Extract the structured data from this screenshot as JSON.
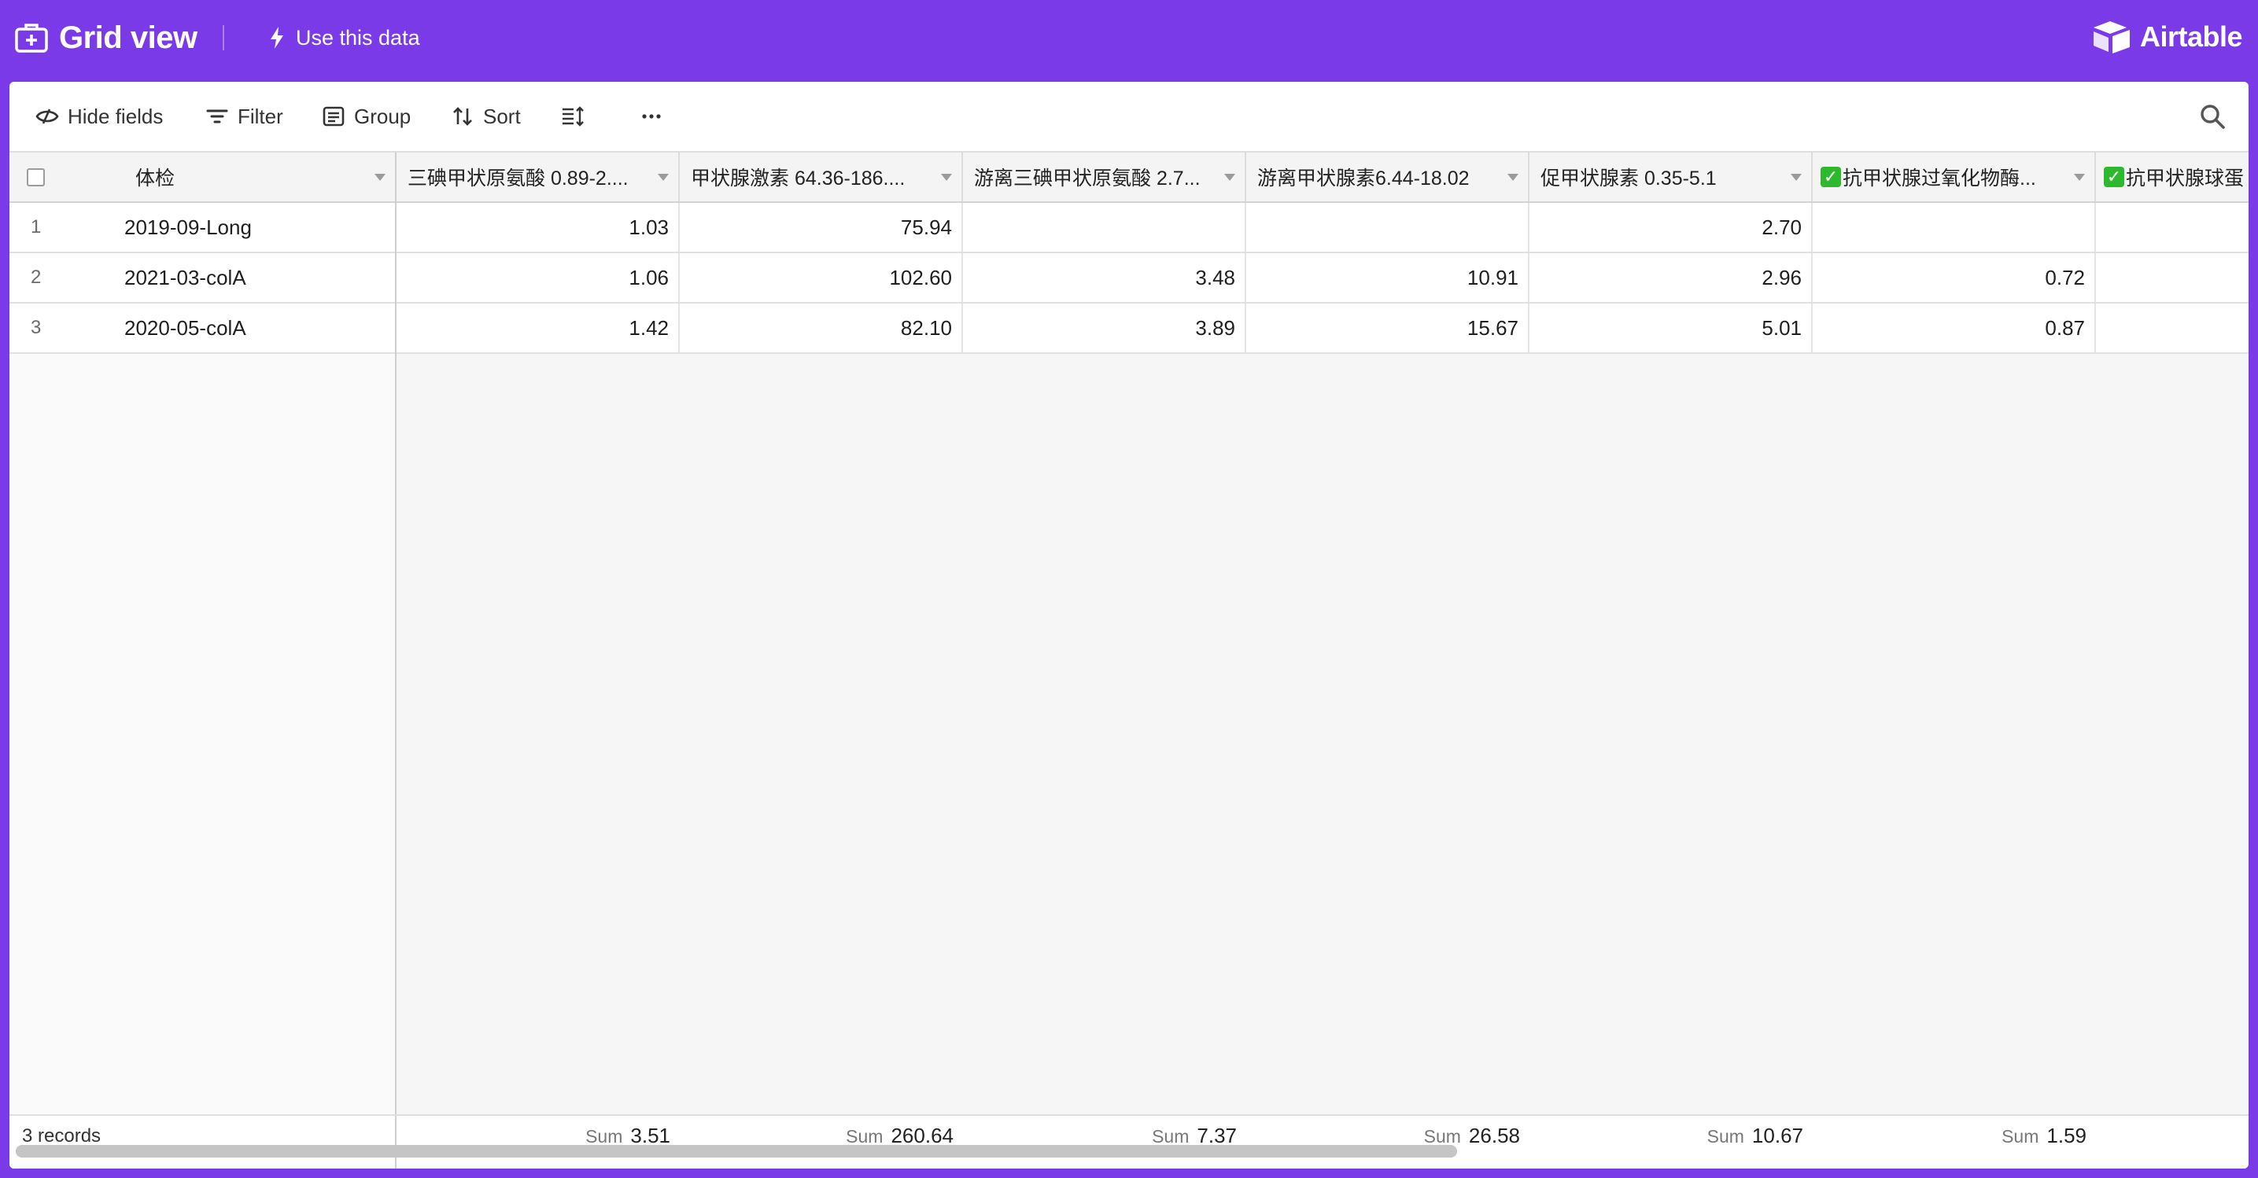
{
  "topbar": {
    "view_title": "Grid view",
    "use_data_label": "Use this data",
    "brand": "Airtable"
  },
  "toolbar": {
    "hide_fields": "Hide fields",
    "filter": "Filter",
    "group": "Group",
    "sort": "Sort"
  },
  "columns": {
    "primary": "体检",
    "c1": "三碘甲状原氨酸 0.89-2....",
    "c2": "甲状腺激素 64.36-186....",
    "c3": "游离三碘甲状原氨酸 2.7...",
    "c4": "游离甲状腺素6.44-18.02",
    "c5": "促甲状腺素 0.35-5.1",
    "c6": "抗甲状腺过氧化物酶...",
    "c7": "抗甲状腺球蛋"
  },
  "rows": [
    {
      "num": "1",
      "name": "2019-09-Long",
      "c1": "1.03",
      "c2": "75.94",
      "c3": "",
      "c4": "",
      "c5": "2.70",
      "c6": "",
      "c7": ""
    },
    {
      "num": "2",
      "name": "2021-03-colA",
      "c1": "1.06",
      "c2": "102.60",
      "c3": "3.48",
      "c4": "10.91",
      "c5": "2.96",
      "c6": "0.72",
      "c7": ""
    },
    {
      "num": "3",
      "name": "2020-05-colA",
      "c1": "1.42",
      "c2": "82.10",
      "c3": "3.89",
      "c4": "15.67",
      "c5": "5.01",
      "c6": "0.87",
      "c7": ""
    }
  ],
  "footer": {
    "records": "3 records",
    "sum_label": "Sum",
    "sums": {
      "c1": "3.51",
      "c2": "260.64",
      "c3": "7.37",
      "c4": "26.58",
      "c5": "10.67",
      "c6": "1.59"
    }
  },
  "colors": {
    "accent": "#7b3ae8",
    "badge": "#2eb82e"
  }
}
